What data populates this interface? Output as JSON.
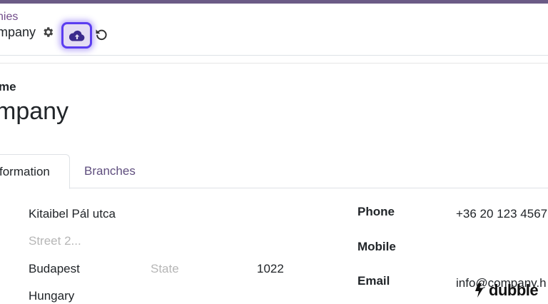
{
  "colors": {
    "accent": "#714b8a",
    "save_highlight": "#5b3df0"
  },
  "breadcrumb": {
    "parent": "nies",
    "current": "mpany"
  },
  "icons": {
    "settings": "gear-icon",
    "save": "cloud-upload-icon",
    "discard": "undo-icon",
    "watermark": "dubble-logo-icon"
  },
  "form": {
    "name_label": "me",
    "title": "mpany",
    "tabs": {
      "general": "formation",
      "branches": "Branches"
    },
    "address": {
      "street": "Kitaibel Pál utca",
      "street2_placeholder": "Street 2...",
      "city": "Budapest",
      "state_placeholder": "State",
      "zip": "1022",
      "country": "Hungary"
    },
    "contact": {
      "phone_label": "Phone",
      "phone": "+36 20 123 4567",
      "mobile_label": "Mobile",
      "mobile": "",
      "email_label": "Email",
      "email": "info@company.h"
    }
  },
  "watermark": {
    "text": "dubble"
  }
}
